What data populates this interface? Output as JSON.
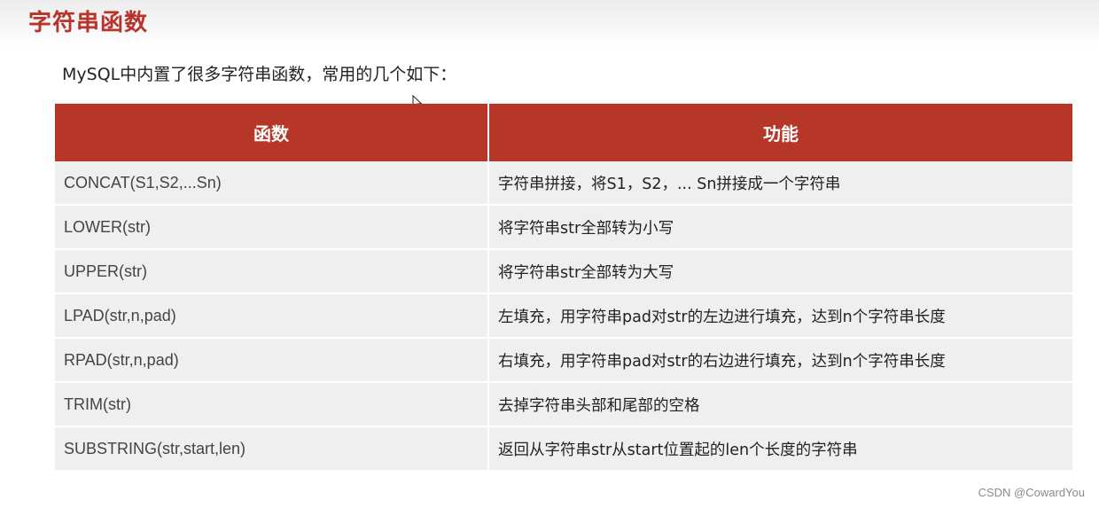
{
  "slide": {
    "title": "字符串函数",
    "intro": "MySQL中内置了很多字符串函数，常用的几个如下："
  },
  "table": {
    "headers": [
      "函数",
      "功能"
    ],
    "rows": [
      [
        "CONCAT(S1,S2,...Sn)",
        "字符串拼接，将S1，S2，... Sn拼接成一个字符串"
      ],
      [
        "LOWER(str)",
        "将字符串str全部转为小写"
      ],
      [
        "UPPER(str)",
        "将字符串str全部转为大写"
      ],
      [
        "LPAD(str,n,pad)",
        "左填充，用字符串pad对str的左边进行填充，达到n个字符串长度"
      ],
      [
        "RPAD(str,n,pad)",
        "右填充，用字符串pad对str的右边进行填充，达到n个字符串长度"
      ],
      [
        "TRIM(str)",
        "去掉字符串头部和尾部的空格"
      ],
      [
        "SUBSTRING(str,start,len)",
        "返回从字符串str从start位置起的len个长度的字符串"
      ]
    ]
  },
  "watermark": "CSDN @CowardYou",
  "colors": {
    "accent": "#b63628",
    "title": "#b8332a",
    "row_bg": "#efefef"
  },
  "icons": {
    "cursor": "mouse-pointer-icon"
  }
}
